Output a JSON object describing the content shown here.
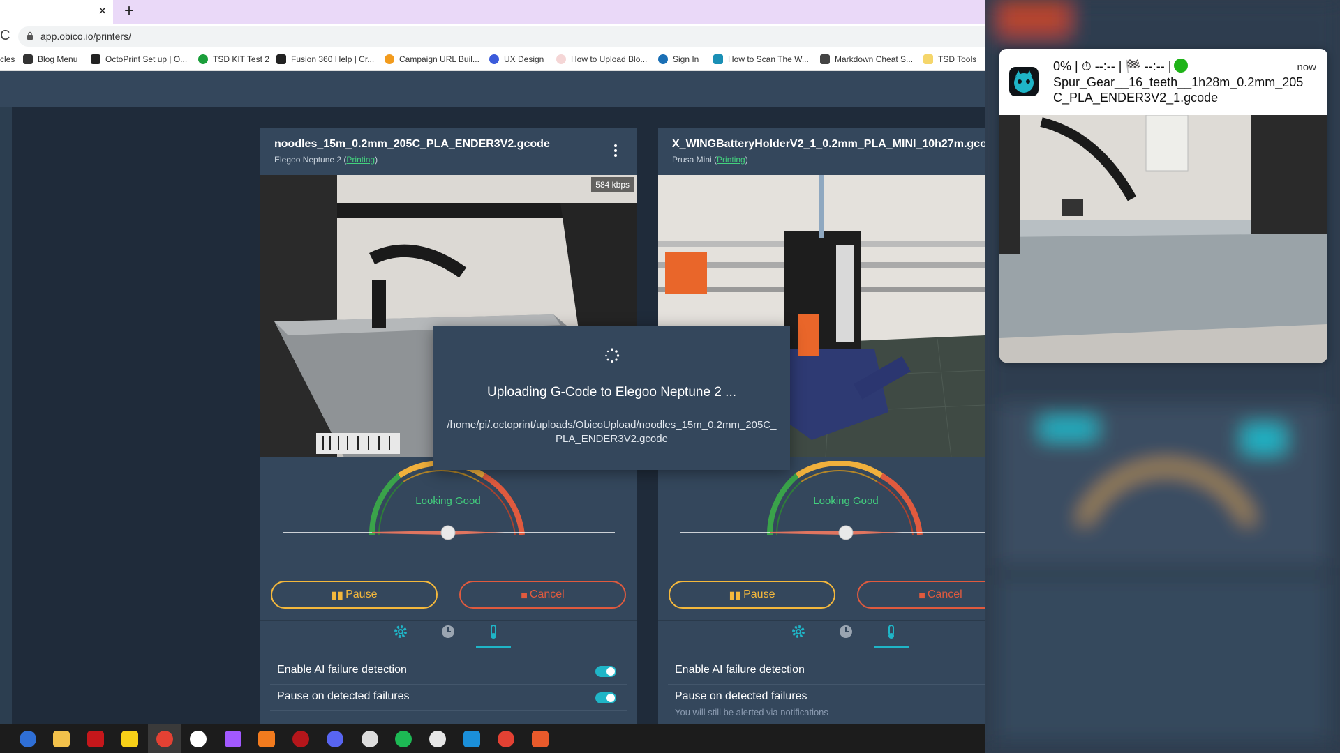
{
  "browser": {
    "tab_close": "×",
    "new_tab": "+",
    "reload": "C",
    "url": "app.obico.io/printers/",
    "bookmarks": [
      {
        "label": "cles",
        "color": "#ffffff"
      },
      {
        "label": "Blog Menu",
        "color": "#333333"
      },
      {
        "label": "OctoPrint Set up | O...",
        "color": "#222222"
      },
      {
        "label": "TSD KIT Test 2",
        "color": "#1a9e3a"
      },
      {
        "label": "Fusion 360 Help | Cr...",
        "color": "#222222"
      },
      {
        "label": "Campaign URL Buil...",
        "color": "#f29b1d"
      },
      {
        "label": "UX Design",
        "color": "#3b5bdb"
      },
      {
        "label": "How to Upload Blo...",
        "color": "#f5d6d6"
      },
      {
        "label": "Sign In",
        "color": "#1a6fb5"
      },
      {
        "label": "How to Scan The W...",
        "color": "#1a8fb5"
      },
      {
        "label": "Markdown Cheat S...",
        "color": "#444444"
      },
      {
        "label": "TSD Tools",
        "color": "#f5d66b"
      }
    ]
  },
  "printers": [
    {
      "filename": "noodles_15m_0.2mm_205C_PLA_ENDER3V2.gcode",
      "printer_name": "Elegoo Neptune 2",
      "status": "Printing",
      "stream_rate": "584 kbps",
      "health_label": "Looking Good",
      "health_level": 0.5,
      "pause_label": "Pause",
      "cancel_label": "Cancel",
      "settings": [
        {
          "label": "Enable AI failure detection",
          "enabled": true
        },
        {
          "label": "Pause on detected failures",
          "enabled": true
        }
      ]
    },
    {
      "filename": "X_WINGBatteryHolderV2_1_0.2mm_PLA_MINI_10h27m.gco...",
      "printer_name": "Prusa Mini",
      "status": "Printing",
      "health_label": "Looking Good",
      "health_level": 0.5,
      "pause_label": "Pause",
      "cancel_label": "Cancel",
      "settings": [
        {
          "label": "Enable AI failure detection",
          "enabled": true
        },
        {
          "label": "Pause on detected failures",
          "enabled": true,
          "hint": "You will still be alerted via notifications"
        }
      ]
    }
  ],
  "modal": {
    "title": "Uploading G-Code to Elegoo Neptune 2 ...",
    "path": "/home/pi/.octoprint/uploads/ObicoUpload/noodles_15m_0.2mm_205C_PLA_ENDER3V2.gcode"
  },
  "notification": {
    "line1": "0% | ⏱ --:-- | 🏁 --:-- |",
    "time": "now",
    "filename": "Spur_Gear__16_teeth__1h28m_0.2mm_205C_PLA_ENDER3V2_1.gcode"
  },
  "taskbar": {
    "apps": [
      "windows-start",
      "file-explorer",
      "acrobat",
      "sticky-notes",
      "chrome",
      "obico",
      "figma",
      "fusion-360",
      "info-app",
      "discord",
      "settings",
      "spotify",
      "slack",
      "cura",
      "chrome-profile",
      "creality"
    ]
  },
  "colors": {
    "accent": "#1fb5c7",
    "pause": "#f4b83c",
    "cancel": "#e05a3e",
    "good": "#43d17e",
    "card": "#34475c",
    "background": "#1f2b3a"
  }
}
